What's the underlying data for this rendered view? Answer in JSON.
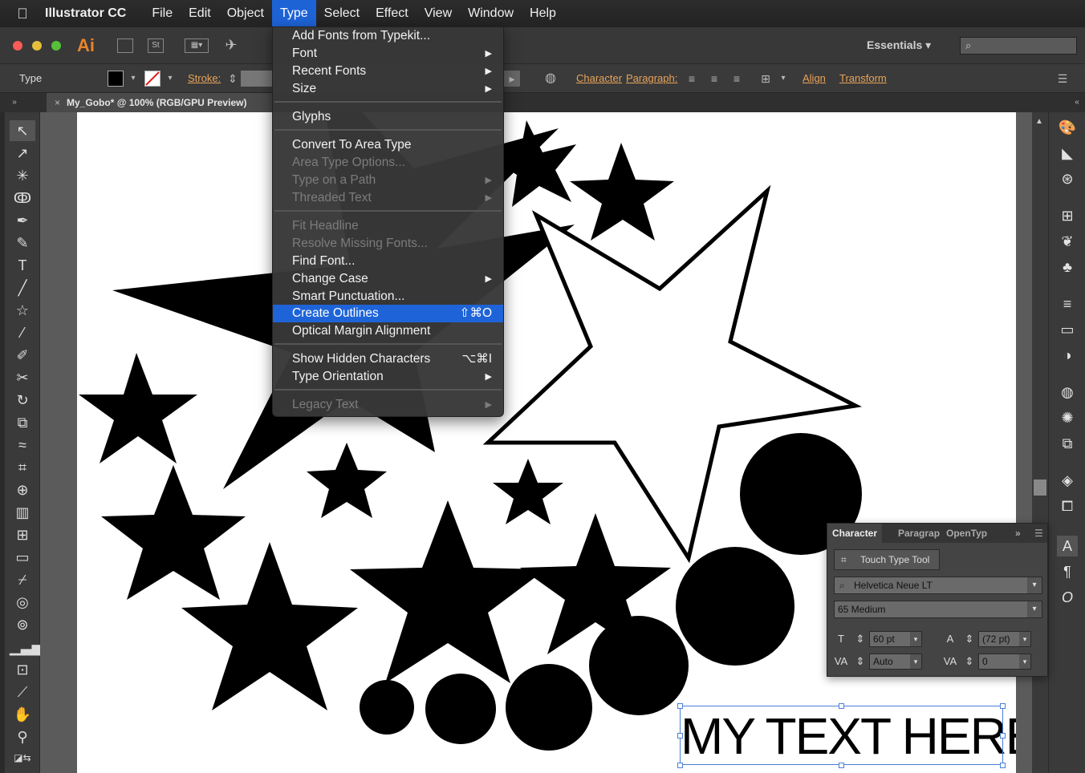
{
  "menubar": {
    "app_name": "Illustrator CC",
    "items": [
      "File",
      "Edit",
      "Object",
      "Type",
      "Select",
      "Effect",
      "View",
      "Window",
      "Help"
    ],
    "active_item": "Type"
  },
  "appbar": {
    "logo": "Ai",
    "st_label": "St",
    "workspace": "Essentials",
    "workspace_chevron": "▾"
  },
  "controlbar": {
    "type_label": "Type",
    "stroke_label": "Stroke:",
    "character_link": "Character",
    "paragraph_link": "Paragraph:",
    "align_link": "Align",
    "transform_link": "Transform"
  },
  "document": {
    "tab_title": "My_Gobo* @ 100% (RGB/GPU Preview)"
  },
  "type_menu": {
    "items": [
      {
        "label": "Add Fonts from Typekit...",
        "enabled": true
      },
      {
        "label": "Font",
        "enabled": true,
        "submenu": true
      },
      {
        "label": "Recent Fonts",
        "enabled": true,
        "submenu": true
      },
      {
        "label": "Size",
        "enabled": true,
        "submenu": true
      },
      {
        "label": "Glyphs",
        "enabled": true
      },
      {
        "label": "Convert To Area Type",
        "enabled": true
      },
      {
        "label": "Area Type Options...",
        "enabled": false
      },
      {
        "label": "Type on a Path",
        "enabled": false,
        "submenu": true
      },
      {
        "label": "Threaded Text",
        "enabled": false,
        "submenu": true
      },
      {
        "label": "Fit Headline",
        "enabled": false
      },
      {
        "label": "Resolve Missing Fonts...",
        "enabled": false
      },
      {
        "label": "Find Font...",
        "enabled": true
      },
      {
        "label": "Change Case",
        "enabled": true,
        "submenu": true
      },
      {
        "label": "Smart Punctuation...",
        "enabled": true
      },
      {
        "label": "Create Outlines",
        "enabled": true,
        "highlighted": true,
        "shortcut": "⇧⌘O"
      },
      {
        "label": "Optical Margin Alignment",
        "enabled": true
      },
      {
        "label": "Show Hidden Characters",
        "enabled": true,
        "shortcut": "⌥⌘I"
      },
      {
        "label": "Type Orientation",
        "enabled": true,
        "submenu": true
      },
      {
        "label": "Legacy Text",
        "enabled": false,
        "submenu": true
      }
    ]
  },
  "character_panel": {
    "tabs": [
      "Character",
      "Paragrap",
      "OpenTyp"
    ],
    "touch_type_tool": "Touch Type Tool",
    "font_family": "Helvetica Neue LT",
    "font_style": "65 Medium",
    "font_size": "60 pt",
    "leading": "(72 pt)",
    "kerning": "Auto",
    "tracking": "0"
  },
  "canvas": {
    "text_object": "MY TEXT HERE"
  },
  "colors": {
    "menu_highlight": "#1e64d8",
    "link_orange": "#e8a35a",
    "selection_blue": "#4a7fd8"
  }
}
